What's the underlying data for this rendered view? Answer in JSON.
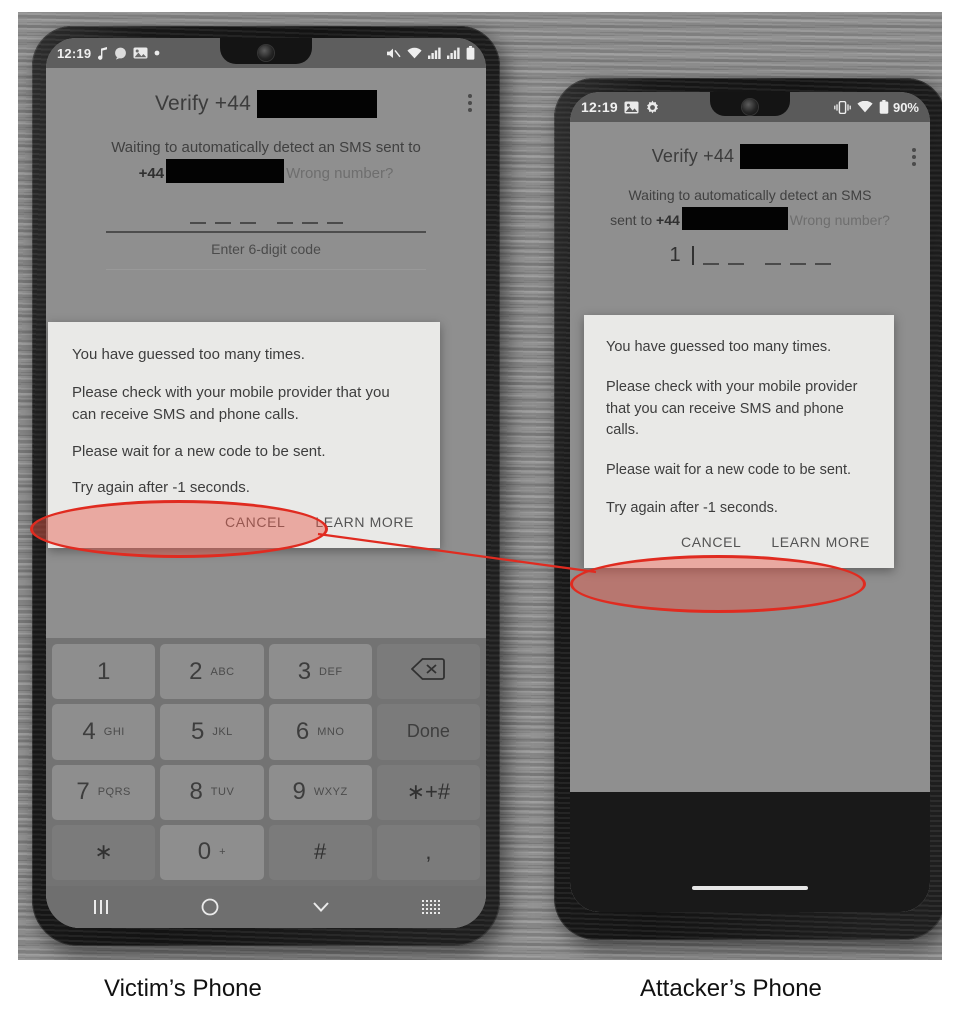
{
  "figure": {
    "caption_left": "Victim’s Phone",
    "caption_right": "Attacker’s Phone",
    "highlight_color": "#e02b20",
    "highlight_fill": "#e85a4b"
  },
  "victim_phone": {
    "status_bar": {
      "time": "12:19",
      "left_icons": [
        "music-note-icon",
        "chat-bubble-icon",
        "photo-icon",
        "dot-icon"
      ],
      "right_icons": [
        "mute-icon",
        "wifi-icon",
        "signal-1-icon",
        "signal-2-icon",
        "battery-icon"
      ]
    },
    "app_bar": {
      "title_prefix": "Verify +44",
      "redacted_number": "",
      "overflow_icon": "kebab-menu-icon"
    },
    "subtitle": {
      "line1": "Waiting to automatically detect an SMS sent to",
      "country_code": "+44",
      "redacted_number": "",
      "wrong_number_link": "Wrong number?"
    },
    "code_entry": {
      "typed_value": "",
      "dash_groups": [
        3,
        3
      ],
      "hint": "Enter 6-digit code"
    },
    "dialog": {
      "paragraph1": "You have guessed too many times.",
      "paragraph2": "Please check with your mobile provider that you can receive SMS and phone calls.",
      "paragraph3": "Please wait for a new code to be sent.",
      "retry_text": "Try again after -1 seconds.",
      "cancel_label": "CANCEL",
      "learn_more_label": "LEARN MORE"
    },
    "keypad": {
      "keys": [
        {
          "num": "1",
          "letters": "",
          "type": "digit"
        },
        {
          "num": "2",
          "letters": "ABC",
          "type": "digit"
        },
        {
          "num": "3",
          "letters": "DEF",
          "type": "digit"
        },
        {
          "num": "",
          "letters": "",
          "type": "backspace",
          "icon": "backspace-icon"
        },
        {
          "num": "4",
          "letters": "GHI",
          "type": "digit"
        },
        {
          "num": "5",
          "letters": "JKL",
          "type": "digit"
        },
        {
          "num": "6",
          "letters": "MNO",
          "type": "digit"
        },
        {
          "num": "",
          "letters": "",
          "type": "action",
          "label": "Done"
        },
        {
          "num": "7",
          "letters": "PQRS",
          "type": "digit"
        },
        {
          "num": "8",
          "letters": "TUV",
          "type": "digit"
        },
        {
          "num": "9",
          "letters": "WXYZ",
          "type": "digit"
        },
        {
          "num": "",
          "letters": "",
          "type": "symbol",
          "label": "∗+#"
        },
        {
          "num": "",
          "letters": "",
          "type": "symbol",
          "label": "∗"
        },
        {
          "num": "0",
          "letters": "+",
          "type": "digit"
        },
        {
          "num": "",
          "letters": "",
          "type": "symbol",
          "label": "#"
        },
        {
          "num": "",
          "letters": "",
          "type": "symbol",
          "label": ","
        }
      ]
    },
    "nav_bar": {
      "icons": [
        "recents-icon",
        "home-icon",
        "back-icon",
        "keyboard-icon"
      ]
    }
  },
  "attacker_phone": {
    "status_bar": {
      "time": "12:19",
      "left_icons": [
        "photo-icon",
        "gear-icon"
      ],
      "right_icons": [
        "vibrate-icon",
        "wifi-icon",
        "battery-icon"
      ],
      "battery_percent": "90%"
    },
    "app_bar": {
      "title_prefix": "Verify +44",
      "redacted_number": "",
      "overflow_icon": "kebab-menu-icon"
    },
    "subtitle": {
      "line1": "Waiting to automatically detect an SMS",
      "line2_prefix": "sent to",
      "country_code": "+44",
      "redacted_number": "",
      "wrong_number_link": "Wrong number?"
    },
    "code_entry": {
      "typed_value": "1",
      "dash_groups": [
        3,
        3
      ],
      "hint": ""
    },
    "dialog": {
      "paragraph1": "You have guessed too many times.",
      "paragraph2": "Please check with your mobile provider that you can receive SMS and phone calls.",
      "paragraph3": "Please wait for a new code to be sent.",
      "retry_text": "Try again after -1 seconds.",
      "cancel_label": "CANCEL",
      "learn_more_label": "LEARN MORE"
    },
    "nav_bar": {
      "icons": [
        "home-gesture-bar"
      ]
    }
  }
}
